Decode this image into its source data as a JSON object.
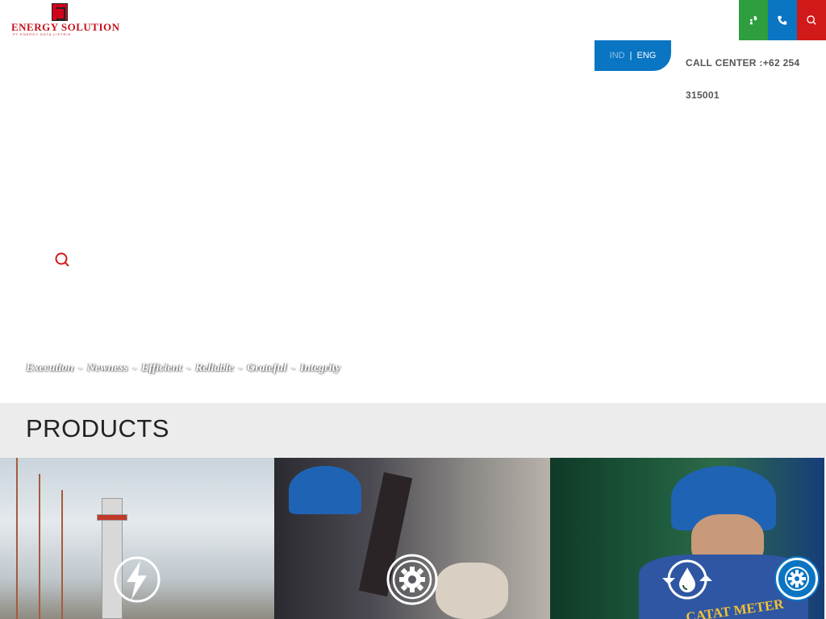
{
  "header": {
    "logo_text": "ENERGY SOLUTION",
    "logo_subtext": "PT ENERGY DATA LISTRIK",
    "buttons": [
      {
        "icon": "leaf-person-icon",
        "color": "#2e9e3e"
      },
      {
        "icon": "phone-icon",
        "color": "#0a75c2"
      },
      {
        "icon": "search-icon",
        "color": "#d11919"
      }
    ],
    "language": {
      "ind": "IND",
      "separator": "|",
      "eng": "ENG",
      "active": "ENG"
    },
    "call_center_label": "CALL CENTER :",
    "call_center_number": "+62 254 315001"
  },
  "hero": {
    "values": [
      "Execution",
      "Newness",
      "Efficient",
      "Reliable",
      "Grateful",
      "Integrity"
    ],
    "separator": "-"
  },
  "products": {
    "title": "PRODUCTS",
    "cards": [
      {
        "icon": "lightning-icon"
      },
      {
        "icon": "gear-icon"
      },
      {
        "icon": "water-drop-cycle-icon",
        "jacket_text": "CATAT METER"
      }
    ]
  },
  "colors": {
    "brand_red": "#d11919",
    "brand_blue": "#0a75c2",
    "brand_green": "#2e9e3e",
    "band_gray": "#ececec"
  }
}
